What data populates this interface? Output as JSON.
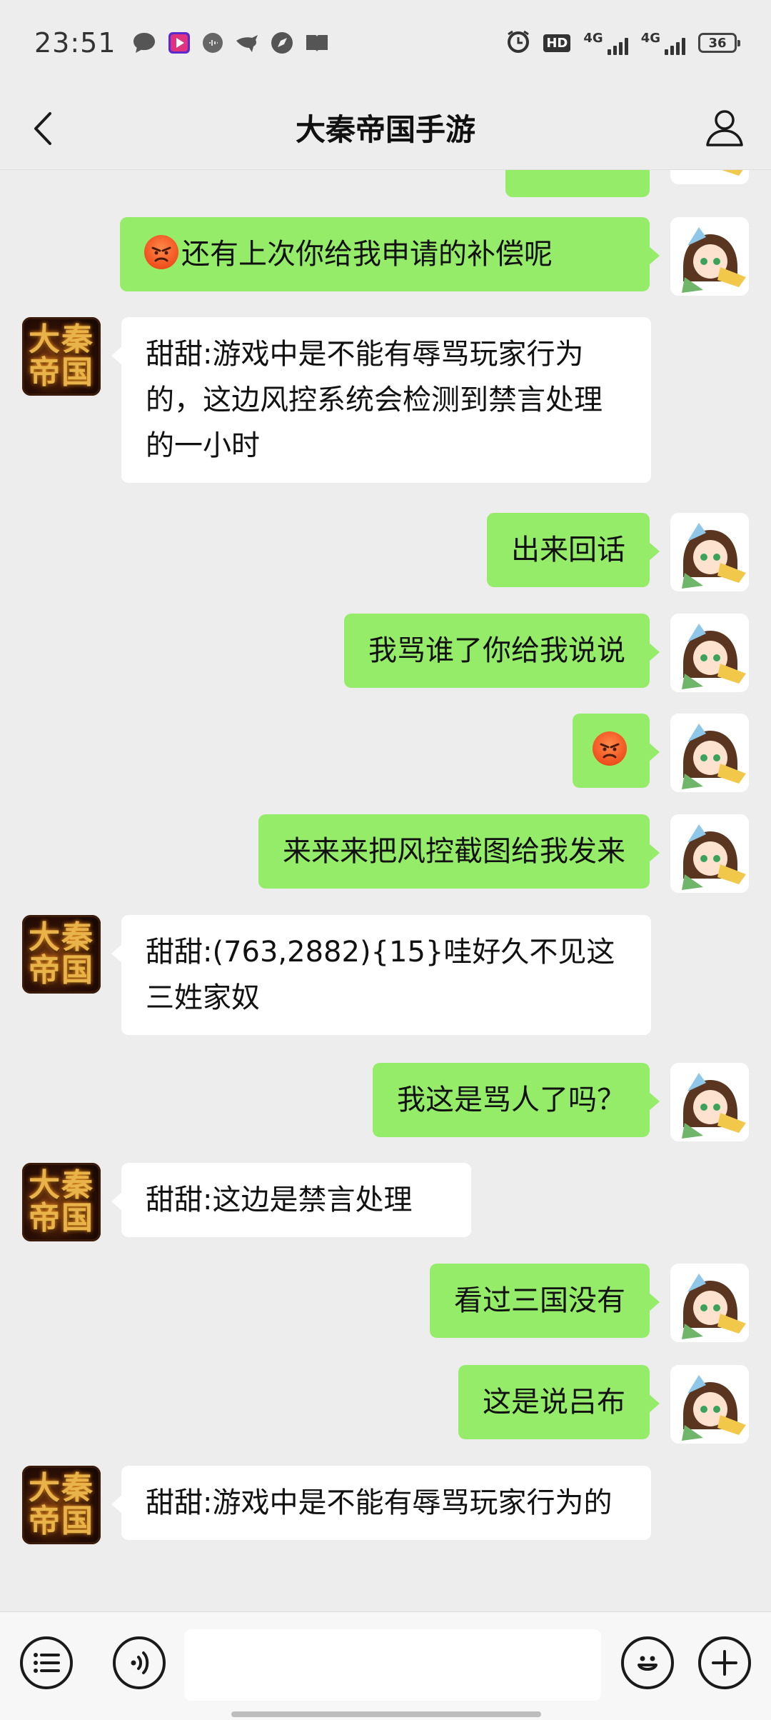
{
  "status_bar": {
    "time": "23:51",
    "signal_1_label": "4G",
    "signal_2_label": "4G",
    "hd_label": "HD",
    "battery_level": "36",
    "notification_icons": [
      "message-bubble-icon",
      "video-app-icon",
      "circle-app-icon",
      "bird-app-icon",
      "compass-app-icon",
      "book-app-icon"
    ]
  },
  "nav": {
    "title": "大秦帝国手游",
    "back_icon": "chevron-left-icon",
    "profile_icon": "person-icon"
  },
  "bot_avatar_text": "大秦\n帝国",
  "messages": [
    {
      "side": "right",
      "text": ""
    },
    {
      "side": "right",
      "text": "还有上次你给我申请的补偿呢",
      "has_angry_emoji": true
    },
    {
      "side": "left",
      "text": "甜甜:游戏中是不能有辱骂玩家行为的，这边风控系统会检测到禁言处理的一小时"
    },
    {
      "side": "right",
      "text": "出来回话"
    },
    {
      "side": "right",
      "text": "我骂谁了你给我说说"
    },
    {
      "side": "right",
      "text": "",
      "has_angry_emoji": true
    },
    {
      "side": "right",
      "text": "来来来把风控截图给我发来"
    },
    {
      "side": "left",
      "text": "甜甜:(763,2882){15}哇好久不见这三姓家奴"
    },
    {
      "side": "right",
      "text": "我这是骂人了吗？"
    },
    {
      "side": "left",
      "text": "甜甜:这边是禁言处理"
    },
    {
      "side": "right",
      "text": "看过三国没有"
    },
    {
      "side": "right",
      "text": "这是说吕布"
    },
    {
      "side": "left",
      "text": "甜甜:游戏中是不能有辱骂玩家行为的"
    }
  ],
  "input_bar": {
    "menu_icon": "list-menu-icon",
    "voice_icon": "voice-icon",
    "emoji_icon": "smiley-icon",
    "plus_icon": "plus-icon",
    "input_value": ""
  },
  "colors": {
    "background": "#ededed",
    "sent_bubble": "#95ec69",
    "received_bubble": "#ffffff"
  }
}
